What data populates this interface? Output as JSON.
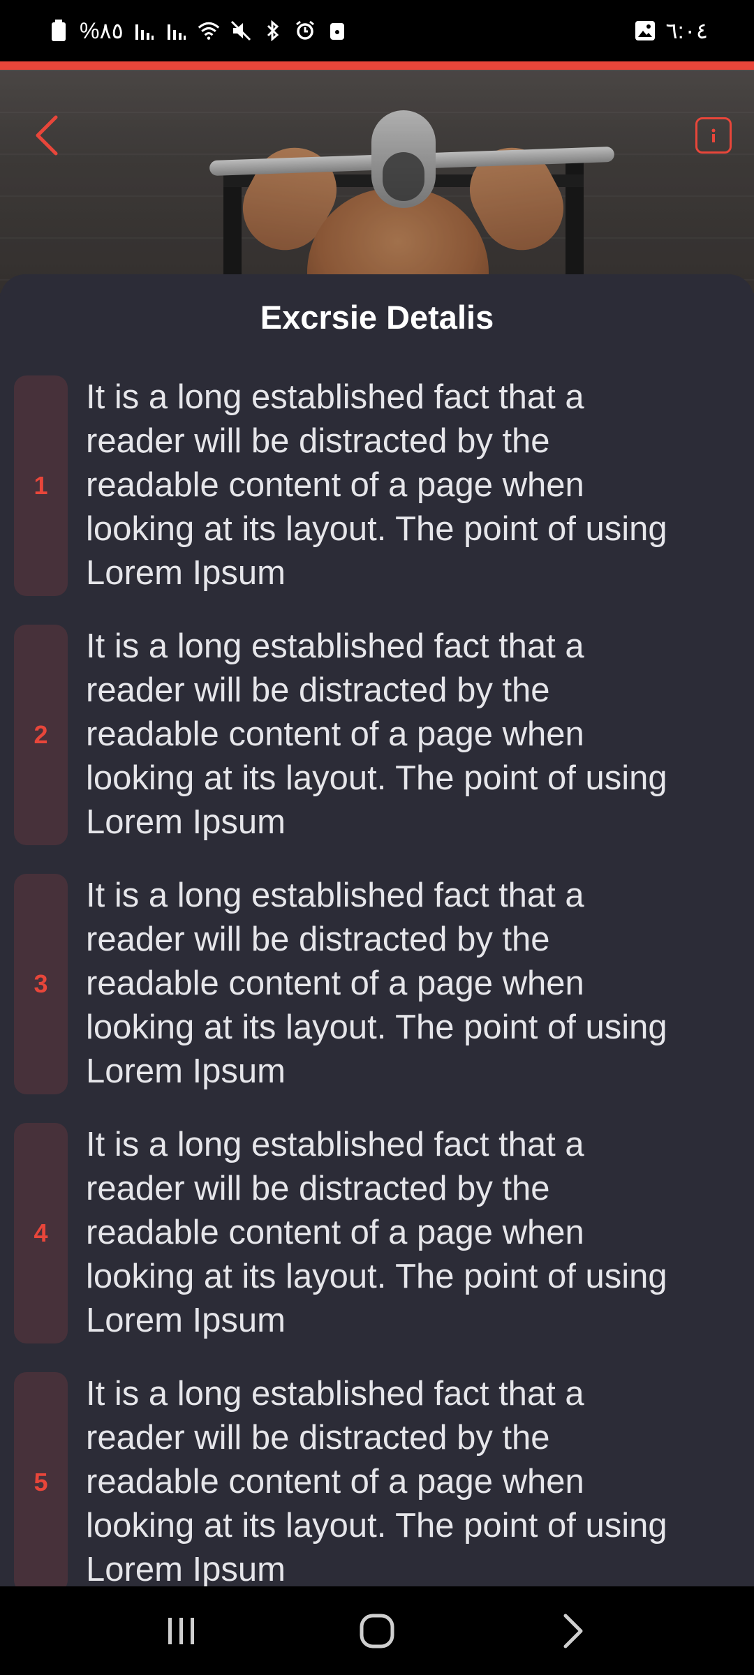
{
  "status_bar": {
    "battery_text": "%٨٥",
    "time": "٦:٠٤",
    "icons": [
      "battery-icon",
      "signal-icon",
      "signal-icon",
      "wifi-icon",
      "mute-icon",
      "bluetooth-icon",
      "alarm-icon",
      "lock-icon",
      "gallery-icon"
    ]
  },
  "colors": {
    "accent": "#e8463a",
    "background": "#2c2c37",
    "badge_bg": "#47313a",
    "text": "#e6e6ea"
  },
  "header": {
    "back_icon": "chevron-left-icon",
    "info_icon": "info-icon"
  },
  "sheet": {
    "title": "Excrsie Detalis",
    "steps": [
      {
        "number": "1",
        "text": "It is a long established fact that a reader will be distracted by the readable content of a page when looking at its layout. The point of using Lorem Ipsum"
      },
      {
        "number": "2",
        "text": "It is a long established fact that a reader will be distracted by the readable content of a page when looking at its layout. The point of using Lorem Ipsum"
      },
      {
        "number": "3",
        "text": "It is a long established fact that a reader will be distracted by the readable content of a page when looking at its layout. The point of using Lorem Ipsum"
      },
      {
        "number": "4",
        "text": "It is a long established fact that a reader will be distracted by the readable content of a page when looking at its layout. The point of using Lorem Ipsum"
      },
      {
        "number": "5",
        "text": "It is a long established fact that a reader will be distracted by the readable content of a page when looking at its layout. The point of using Lorem Ipsum"
      }
    ]
  },
  "nav_bar": {
    "icons": [
      "recent-apps-icon",
      "home-icon",
      "back-icon"
    ]
  }
}
